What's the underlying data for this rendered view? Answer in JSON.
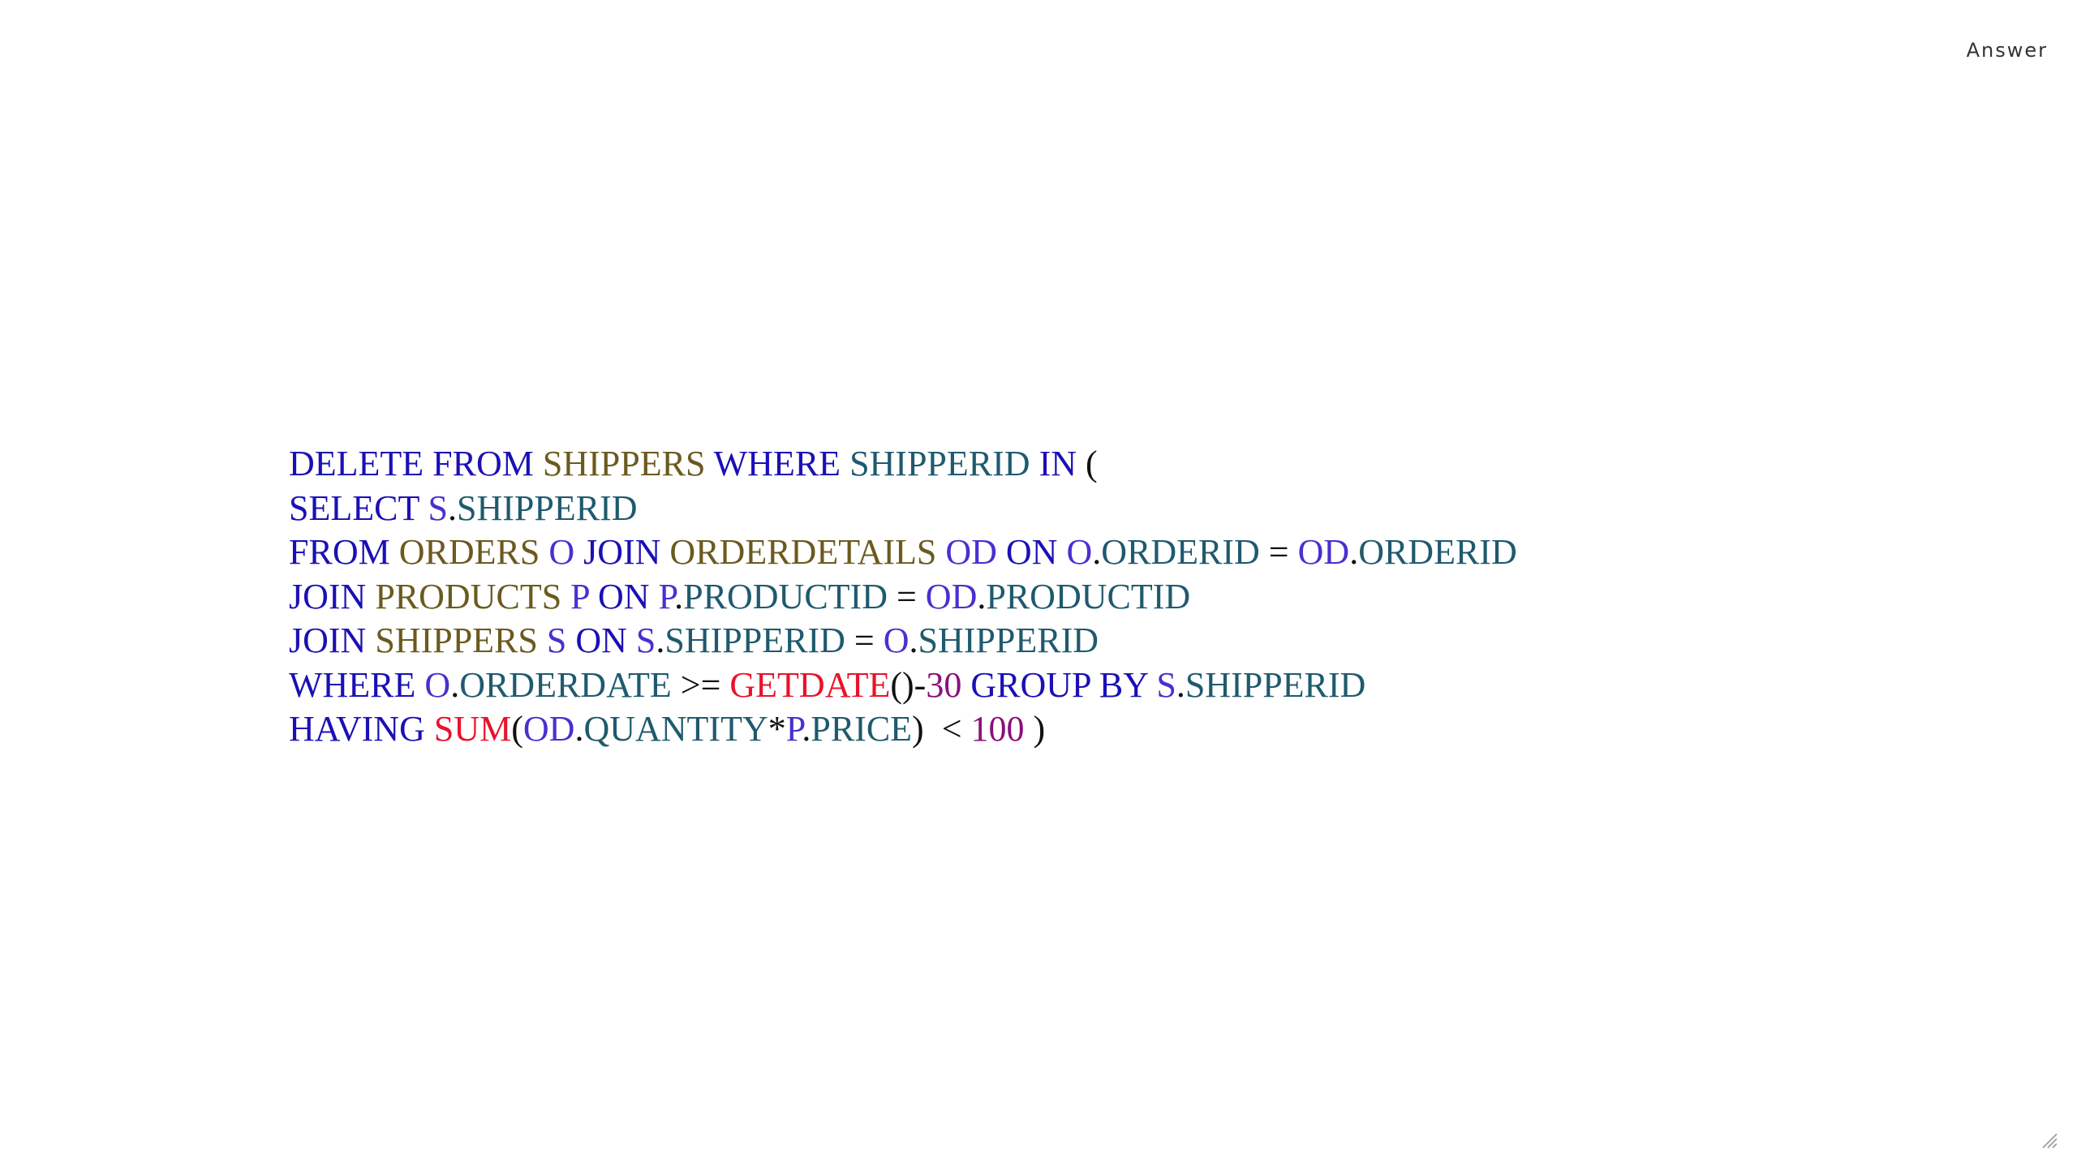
{
  "header": {
    "label": "Answer"
  },
  "colors": {
    "keyword": "#1a10b5",
    "table": "#6b5a1e",
    "alias": "#4a2fd0",
    "column": "#1f5a6e",
    "function": "#e8132b",
    "number": "#8a0f7a",
    "punct": "#111111"
  },
  "code": {
    "lines": [
      [
        {
          "t": "DELETE FROM ",
          "c": "keyword"
        },
        {
          "t": "SHIPPERS",
          "c": "table"
        },
        {
          "t": " ",
          "c": "punct"
        },
        {
          "t": "WHERE",
          "c": "keyword"
        },
        {
          "t": " ",
          "c": "punct"
        },
        {
          "t": "SHIPPERID",
          "c": "column"
        },
        {
          "t": " ",
          "c": "punct"
        },
        {
          "t": "IN",
          "c": "keyword"
        },
        {
          "t": " (",
          "c": "punct"
        }
      ],
      [
        {
          "t": "SELECT",
          "c": "keyword"
        },
        {
          "t": " ",
          "c": "punct"
        },
        {
          "t": "S",
          "c": "alias"
        },
        {
          "t": ".",
          "c": "punct"
        },
        {
          "t": "SHIPPERID",
          "c": "column"
        }
      ],
      [
        {
          "t": "FROM",
          "c": "keyword"
        },
        {
          "t": " ",
          "c": "punct"
        },
        {
          "t": "ORDERS",
          "c": "table"
        },
        {
          "t": " ",
          "c": "punct"
        },
        {
          "t": "O",
          "c": "alias"
        },
        {
          "t": " ",
          "c": "punct"
        },
        {
          "t": "JOIN",
          "c": "keyword"
        },
        {
          "t": " ",
          "c": "punct"
        },
        {
          "t": "ORDERDETAILS",
          "c": "table"
        },
        {
          "t": " ",
          "c": "punct"
        },
        {
          "t": "OD",
          "c": "alias"
        },
        {
          "t": " ",
          "c": "punct"
        },
        {
          "t": "ON",
          "c": "keyword"
        },
        {
          "t": " ",
          "c": "punct"
        },
        {
          "t": "O",
          "c": "alias"
        },
        {
          "t": ".",
          "c": "punct"
        },
        {
          "t": "ORDERID",
          "c": "column"
        },
        {
          "t": " = ",
          "c": "punct"
        },
        {
          "t": "OD",
          "c": "alias"
        },
        {
          "t": ".",
          "c": "punct"
        },
        {
          "t": "ORDERID",
          "c": "column"
        }
      ],
      [
        {
          "t": "JOIN",
          "c": "keyword"
        },
        {
          "t": " ",
          "c": "punct"
        },
        {
          "t": "PRODUCTS",
          "c": "table"
        },
        {
          "t": " ",
          "c": "punct"
        },
        {
          "t": "P",
          "c": "alias"
        },
        {
          "t": " ",
          "c": "punct"
        },
        {
          "t": "ON",
          "c": "keyword"
        },
        {
          "t": " ",
          "c": "punct"
        },
        {
          "t": "P",
          "c": "alias"
        },
        {
          "t": ".",
          "c": "punct"
        },
        {
          "t": "PRODUCTID",
          "c": "column"
        },
        {
          "t": " = ",
          "c": "punct"
        },
        {
          "t": "OD",
          "c": "alias"
        },
        {
          "t": ".",
          "c": "punct"
        },
        {
          "t": "PRODUCTID",
          "c": "column"
        }
      ],
      [
        {
          "t": "JOIN",
          "c": "keyword"
        },
        {
          "t": " ",
          "c": "punct"
        },
        {
          "t": "SHIPPERS",
          "c": "table"
        },
        {
          "t": " ",
          "c": "punct"
        },
        {
          "t": "S",
          "c": "alias"
        },
        {
          "t": " ",
          "c": "punct"
        },
        {
          "t": "ON",
          "c": "keyword"
        },
        {
          "t": " ",
          "c": "punct"
        },
        {
          "t": "S",
          "c": "alias"
        },
        {
          "t": ".",
          "c": "punct"
        },
        {
          "t": "SHIPPERID",
          "c": "column"
        },
        {
          "t": " = ",
          "c": "punct"
        },
        {
          "t": "O",
          "c": "alias"
        },
        {
          "t": ".",
          "c": "punct"
        },
        {
          "t": "SHIPPERID",
          "c": "column"
        }
      ],
      [
        {
          "t": "WHERE",
          "c": "keyword"
        },
        {
          "t": " ",
          "c": "punct"
        },
        {
          "t": "O",
          "c": "alias"
        },
        {
          "t": ".",
          "c": "punct"
        },
        {
          "t": "ORDERDATE",
          "c": "column"
        },
        {
          "t": " >= ",
          "c": "punct"
        },
        {
          "t": "GETDATE",
          "c": "function"
        },
        {
          "t": "()-",
          "c": "punct"
        },
        {
          "t": "30",
          "c": "number"
        },
        {
          "t": " ",
          "c": "punct"
        },
        {
          "t": "GROUP BY",
          "c": "keyword"
        },
        {
          "t": " ",
          "c": "punct"
        },
        {
          "t": "S",
          "c": "alias"
        },
        {
          "t": ".",
          "c": "punct"
        },
        {
          "t": "SHIPPERID",
          "c": "column"
        }
      ],
      [
        {
          "t": "HAVING",
          "c": "keyword"
        },
        {
          "t": " ",
          "c": "punct"
        },
        {
          "t": "SUM",
          "c": "function"
        },
        {
          "t": "(",
          "c": "punct"
        },
        {
          "t": "OD",
          "c": "alias"
        },
        {
          "t": ".",
          "c": "punct"
        },
        {
          "t": "QUANTITY",
          "c": "column"
        },
        {
          "t": "*",
          "c": "punct"
        },
        {
          "t": "P",
          "c": "alias"
        },
        {
          "t": ".",
          "c": "punct"
        },
        {
          "t": "PRICE",
          "c": "column"
        },
        {
          "t": ")  < ",
          "c": "punct"
        },
        {
          "t": "100",
          "c": "number"
        },
        {
          "t": " )",
          "c": "punct"
        }
      ]
    ]
  },
  "resize_handle": {
    "icon": "resize-grip-icon"
  }
}
